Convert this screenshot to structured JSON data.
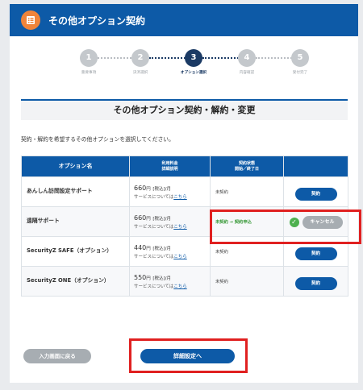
{
  "header": {
    "title": "その他オプション契約",
    "icon": "document-list-icon",
    "bg_color": "#0d5aa7",
    "icon_color": "#f0843a"
  },
  "steps": [
    {
      "number": "1",
      "label": "重要事項",
      "active": false
    },
    {
      "number": "2",
      "label": "決済選択",
      "active": false
    },
    {
      "number": "3",
      "label": "オプション選択",
      "active": true
    },
    {
      "number": "4",
      "label": "内容確認",
      "active": false
    },
    {
      "number": "5",
      "label": "受付完了",
      "active": false
    }
  ],
  "section": {
    "title": "その他オプション契約・解約・変更",
    "instruction": "契約・解約を希望するその他オプションを選択してください。"
  },
  "table": {
    "headers": {
      "option": "オプション名",
      "fee_line1": "利用料金",
      "fee_line2": "詳細説明",
      "status_line1": "契約状態",
      "status_line2": "開始／終了日"
    },
    "rows": [
      {
        "name": "あんしん訪問設定サポート",
        "price": "660",
        "yen": "円",
        "tax": "[税込]/月",
        "note": "サービスについては",
        "link": "こちら",
        "status": "未契約",
        "action": "契約"
      },
      {
        "name": "遠隔サポート",
        "price": "660",
        "yen": "円",
        "tax": "[税込]/月",
        "note": "サービスについては",
        "link": "こちら",
        "status": "未契約",
        "arrow": "→",
        "status_new": "契約申込",
        "action": "キャンセル",
        "selected": true
      },
      {
        "name": "SecurityZ SAFE（オプション）",
        "price": "440",
        "yen": "円",
        "tax": "[税込]/月",
        "note": "サービスについては",
        "link": "こちら",
        "status": "未契約",
        "action": "契約"
      },
      {
        "name": "SecurityZ ONE（オプション）",
        "price": "550",
        "yen": "円",
        "tax": "[税込]/月",
        "note": "サービスについては",
        "link": "こちら",
        "status": "未契約",
        "action": "契約"
      }
    ]
  },
  "buttons": {
    "back": "入力画面に戻る",
    "next": "詳細設定へ"
  },
  "colors": {
    "primary": "#0d5aa7",
    "step_active": "#1b3a64",
    "highlight": "#e02020",
    "success": "#4db04f",
    "disabled": "#a7adb2"
  }
}
